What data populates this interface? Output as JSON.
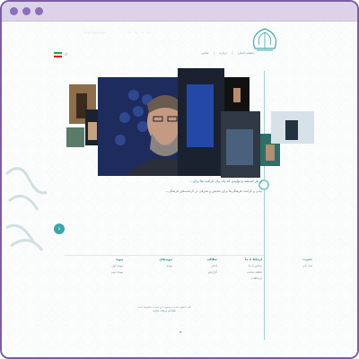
{
  "window": {
    "titlebar_color": "#dcd2ea",
    "dot_color": "#8b6fba"
  },
  "header": {
    "logo_text": "",
    "nav": [
      "صفحه اصلی",
      "|",
      "درباره",
      "|",
      "تماس"
    ],
    "search_icon": "search-icon",
    "flag": "iran-flag-icon"
  },
  "headline": "از هر اندیشه و تولیدی که یک بیان کرامت ها برای...",
  "body": "بیانی و کرامت فرهنگی‌ها برای نمایش و معرفی در کرامت‌های فرهنگی...",
  "arrow": "›",
  "footer": {
    "cols": [
      {
        "head": "ارتباط با ما",
        "items": [
          "تماس با ما",
          "نقشه سایت",
          "ارتباطات"
        ]
      },
      {
        "head": "مطالب",
        "items": [
          "اخبار",
          "گزارش"
        ]
      },
      {
        "head": "پیوندهای",
        "items": [
          "پیوند"
        ]
      },
      {
        "head": "پیوند",
        "items": [
          "پیوند اول",
          "پیوند دوم"
        ]
      }
    ],
    "side": {
      "head": "عضویت",
      "item": "ثبت نام"
    },
    "copyright": "کلیه حقوق مادی و معنوی این سایت محفوظ است",
    "copyright_link": "طراحی و پیاده سازی"
  }
}
